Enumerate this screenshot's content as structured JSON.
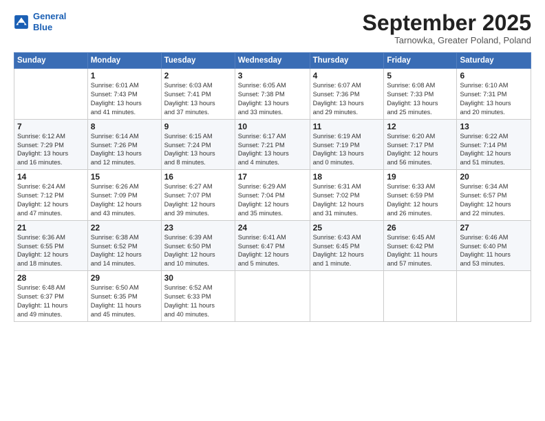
{
  "header": {
    "logo_line1": "General",
    "logo_line2": "Blue",
    "month": "September 2025",
    "location": "Tarnowka, Greater Poland, Poland"
  },
  "weekdays": [
    "Sunday",
    "Monday",
    "Tuesday",
    "Wednesday",
    "Thursday",
    "Friday",
    "Saturday"
  ],
  "weeks": [
    [
      {
        "day": "",
        "info": ""
      },
      {
        "day": "1",
        "info": "Sunrise: 6:01 AM\nSunset: 7:43 PM\nDaylight: 13 hours\nand 41 minutes."
      },
      {
        "day": "2",
        "info": "Sunrise: 6:03 AM\nSunset: 7:41 PM\nDaylight: 13 hours\nand 37 minutes."
      },
      {
        "day": "3",
        "info": "Sunrise: 6:05 AM\nSunset: 7:38 PM\nDaylight: 13 hours\nand 33 minutes."
      },
      {
        "day": "4",
        "info": "Sunrise: 6:07 AM\nSunset: 7:36 PM\nDaylight: 13 hours\nand 29 minutes."
      },
      {
        "day": "5",
        "info": "Sunrise: 6:08 AM\nSunset: 7:33 PM\nDaylight: 13 hours\nand 25 minutes."
      },
      {
        "day": "6",
        "info": "Sunrise: 6:10 AM\nSunset: 7:31 PM\nDaylight: 13 hours\nand 20 minutes."
      }
    ],
    [
      {
        "day": "7",
        "info": "Sunrise: 6:12 AM\nSunset: 7:29 PM\nDaylight: 13 hours\nand 16 minutes."
      },
      {
        "day": "8",
        "info": "Sunrise: 6:14 AM\nSunset: 7:26 PM\nDaylight: 13 hours\nand 12 minutes."
      },
      {
        "day": "9",
        "info": "Sunrise: 6:15 AM\nSunset: 7:24 PM\nDaylight: 13 hours\nand 8 minutes."
      },
      {
        "day": "10",
        "info": "Sunrise: 6:17 AM\nSunset: 7:21 PM\nDaylight: 13 hours\nand 4 minutes."
      },
      {
        "day": "11",
        "info": "Sunrise: 6:19 AM\nSunset: 7:19 PM\nDaylight: 13 hours\nand 0 minutes."
      },
      {
        "day": "12",
        "info": "Sunrise: 6:20 AM\nSunset: 7:17 PM\nDaylight: 12 hours\nand 56 minutes."
      },
      {
        "day": "13",
        "info": "Sunrise: 6:22 AM\nSunset: 7:14 PM\nDaylight: 12 hours\nand 51 minutes."
      }
    ],
    [
      {
        "day": "14",
        "info": "Sunrise: 6:24 AM\nSunset: 7:12 PM\nDaylight: 12 hours\nand 47 minutes."
      },
      {
        "day": "15",
        "info": "Sunrise: 6:26 AM\nSunset: 7:09 PM\nDaylight: 12 hours\nand 43 minutes."
      },
      {
        "day": "16",
        "info": "Sunrise: 6:27 AM\nSunset: 7:07 PM\nDaylight: 12 hours\nand 39 minutes."
      },
      {
        "day": "17",
        "info": "Sunrise: 6:29 AM\nSunset: 7:04 PM\nDaylight: 12 hours\nand 35 minutes."
      },
      {
        "day": "18",
        "info": "Sunrise: 6:31 AM\nSunset: 7:02 PM\nDaylight: 12 hours\nand 31 minutes."
      },
      {
        "day": "19",
        "info": "Sunrise: 6:33 AM\nSunset: 6:59 PM\nDaylight: 12 hours\nand 26 minutes."
      },
      {
        "day": "20",
        "info": "Sunrise: 6:34 AM\nSunset: 6:57 PM\nDaylight: 12 hours\nand 22 minutes."
      }
    ],
    [
      {
        "day": "21",
        "info": "Sunrise: 6:36 AM\nSunset: 6:55 PM\nDaylight: 12 hours\nand 18 minutes."
      },
      {
        "day": "22",
        "info": "Sunrise: 6:38 AM\nSunset: 6:52 PM\nDaylight: 12 hours\nand 14 minutes."
      },
      {
        "day": "23",
        "info": "Sunrise: 6:39 AM\nSunset: 6:50 PM\nDaylight: 12 hours\nand 10 minutes."
      },
      {
        "day": "24",
        "info": "Sunrise: 6:41 AM\nSunset: 6:47 PM\nDaylight: 12 hours\nand 5 minutes."
      },
      {
        "day": "25",
        "info": "Sunrise: 6:43 AM\nSunset: 6:45 PM\nDaylight: 12 hours\nand 1 minute."
      },
      {
        "day": "26",
        "info": "Sunrise: 6:45 AM\nSunset: 6:42 PM\nDaylight: 11 hours\nand 57 minutes."
      },
      {
        "day": "27",
        "info": "Sunrise: 6:46 AM\nSunset: 6:40 PM\nDaylight: 11 hours\nand 53 minutes."
      }
    ],
    [
      {
        "day": "28",
        "info": "Sunrise: 6:48 AM\nSunset: 6:37 PM\nDaylight: 11 hours\nand 49 minutes."
      },
      {
        "day": "29",
        "info": "Sunrise: 6:50 AM\nSunset: 6:35 PM\nDaylight: 11 hours\nand 45 minutes."
      },
      {
        "day": "30",
        "info": "Sunrise: 6:52 AM\nSunset: 6:33 PM\nDaylight: 11 hours\nand 40 minutes."
      },
      {
        "day": "",
        "info": ""
      },
      {
        "day": "",
        "info": ""
      },
      {
        "day": "",
        "info": ""
      },
      {
        "day": "",
        "info": ""
      }
    ]
  ]
}
